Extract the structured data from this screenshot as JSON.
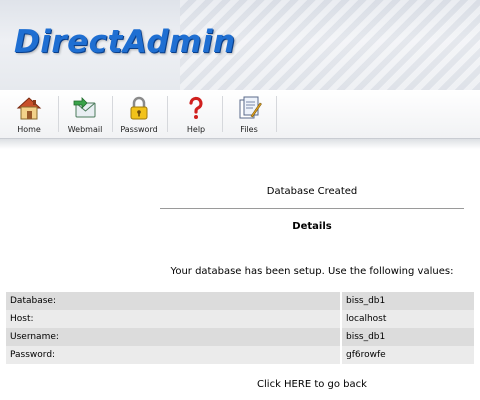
{
  "app": {
    "brand": "DirectAdmin"
  },
  "toolbar": {
    "items": [
      {
        "label": "Home",
        "icon": "home-icon"
      },
      {
        "label": "Webmail",
        "icon": "webmail-icon"
      },
      {
        "label": "Password",
        "icon": "lock-icon"
      },
      {
        "label": "Help",
        "icon": "help-icon"
      },
      {
        "label": "Files",
        "icon": "files-icon"
      }
    ]
  },
  "main": {
    "title": "Database Created",
    "subtitle": "Details",
    "intro": "Your database has been setup.  Use the following values:",
    "rows": [
      {
        "key": "Database:",
        "value": "biss_db1"
      },
      {
        "key": "Host:",
        "value": "localhost"
      },
      {
        "key": "Username:",
        "value": "biss_db1"
      },
      {
        "key": "Password:",
        "value": "gf6rowfe"
      }
    ],
    "back_link": "Click HERE to go back"
  },
  "colors": {
    "brand": "#1f6fd2",
    "row_dark": "#dcdcdc",
    "row_light": "#ebebeb"
  }
}
